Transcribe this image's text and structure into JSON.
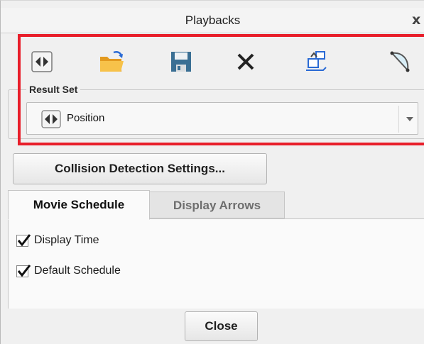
{
  "dialog": {
    "title": "Playbacks",
    "close_glyph": "x"
  },
  "toolbar": {
    "items": [
      {
        "icon": "play-arrows-icon"
      },
      {
        "icon": "open-folder-icon"
      },
      {
        "icon": "save-icon"
      },
      {
        "icon": "delete-x-icon"
      },
      {
        "icon": "export-icon"
      },
      {
        "icon": "clearance-icon"
      }
    ]
  },
  "result_set": {
    "label": "Result Set",
    "selected": "Position"
  },
  "collision_button": "Collision Detection Settings...",
  "tabs": [
    {
      "label": "Movie Schedule",
      "active": true
    },
    {
      "label": "Display Arrows",
      "active": false
    }
  ],
  "options": [
    {
      "label": "Display Time",
      "checked": true
    },
    {
      "label": "Default Schedule",
      "checked": true
    }
  ],
  "close_button": "Close",
  "colors": {
    "highlight": "#e81e2a",
    "folder": "#f2b33a",
    "disk": "#3a6f94"
  }
}
